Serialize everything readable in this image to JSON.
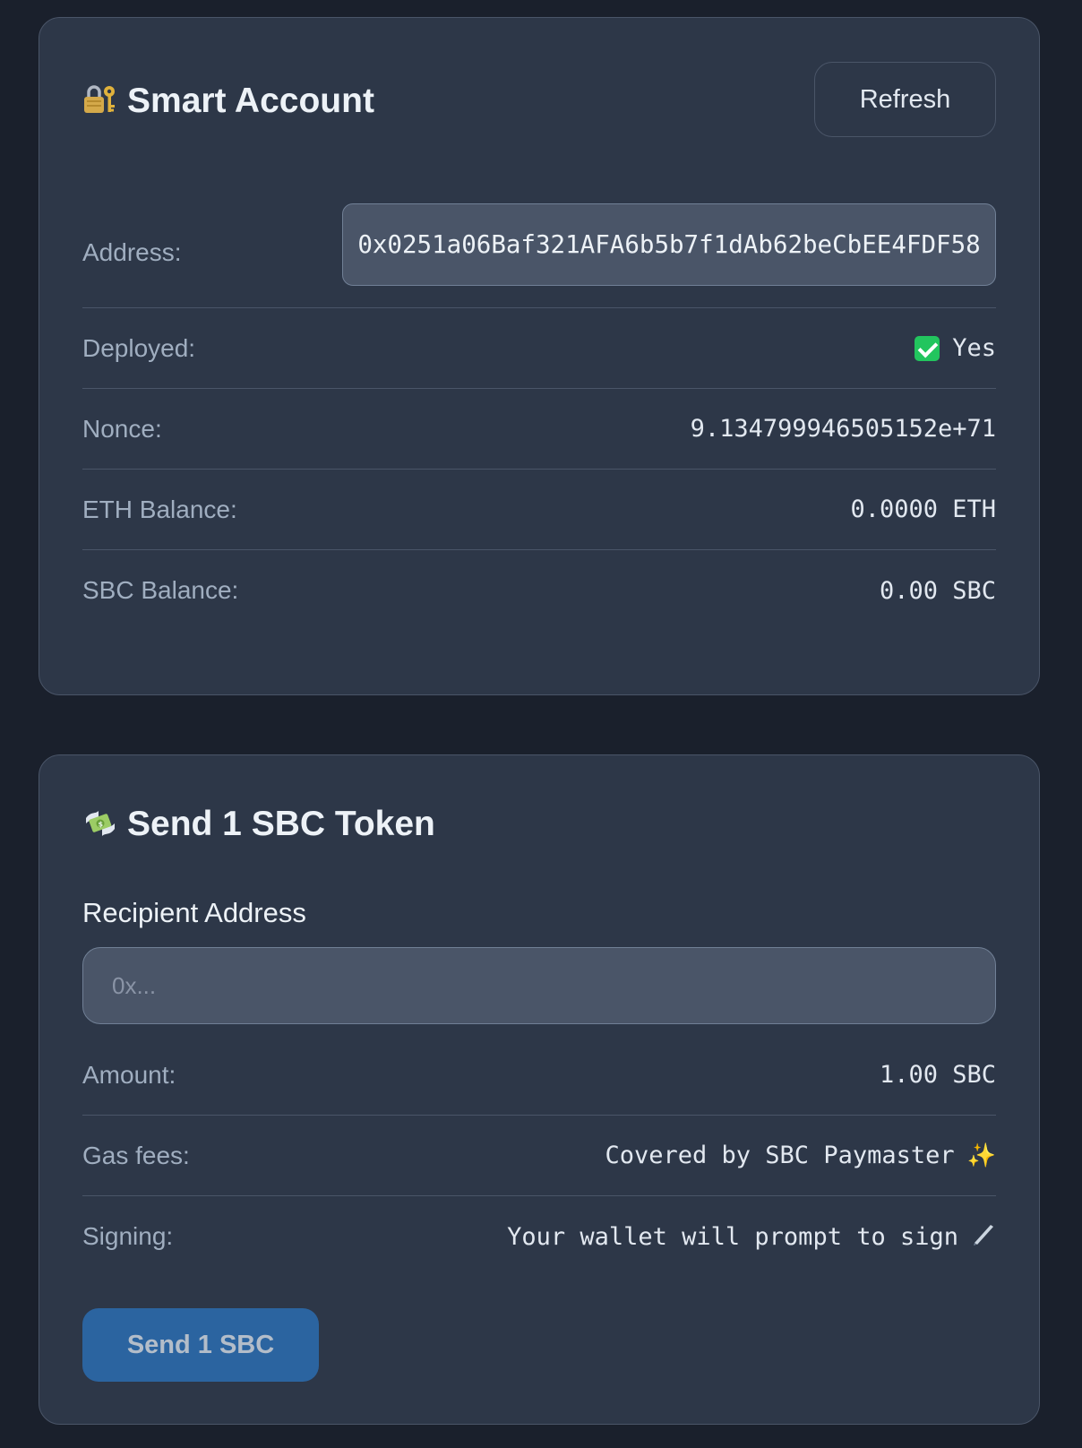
{
  "account": {
    "title_icon": "locked-with-key-icon",
    "title": "Smart Account",
    "refresh_label": "Refresh",
    "address_label": "Address:",
    "address_value": "0x0251a06Baf321AFA6b5b7f1dAb62beCbEE4FDF58",
    "deployed_label": "Deployed:",
    "deployed_icon": "check-mark-icon",
    "deployed_value": "Yes",
    "nonce_label": "Nonce:",
    "nonce_value": "9.134799946505152e+71",
    "eth_label": "ETH Balance:",
    "eth_value": "0.0000 ETH",
    "sbc_label": "SBC Balance:",
    "sbc_value": "0.00 SBC"
  },
  "send": {
    "title_icon": "money-with-wings-icon",
    "title": "Send 1 SBC Token",
    "recipient_label": "Recipient Address",
    "recipient_placeholder": "0x...",
    "recipient_value": "",
    "amount_label": "Amount:",
    "amount_value": "1.00 SBC",
    "gas_label": "Gas fees:",
    "gas_value": "Covered by SBC Paymaster",
    "gas_icon": "sparkles-icon",
    "signing_label": "Signing:",
    "signing_value": "Your wallet will prompt to sign",
    "signing_icon": "pen-icon",
    "button_label": "Send 1 SBC"
  },
  "colors": {
    "background": "#1a202c",
    "card": "#2d3748",
    "border": "#4a5568",
    "accent_button": "#2b6cb0",
    "success": "#22c55e"
  }
}
